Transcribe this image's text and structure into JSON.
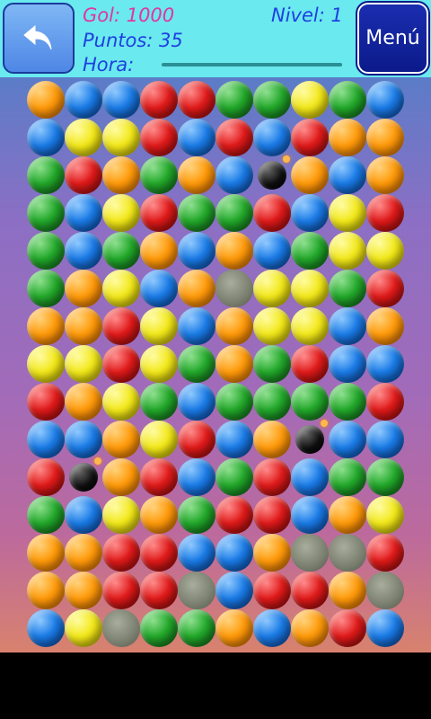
{
  "header": {
    "gol_label": "Gol: 1000",
    "nivel_label": "Nivel: 1",
    "puntos_label": "Puntos: 35",
    "hora_label": "Hora:",
    "menu_label": "Menú",
    "time_remaining_fraction": 1.0
  },
  "colors": {
    "orange": "#ff9a0a",
    "blue": "#1a7be6",
    "red": "#e01a1a",
    "green": "#22a82a",
    "yellow": "#f2e81a",
    "rock": "#7d8272",
    "bomb": "#111111"
  },
  "board": {
    "rows": [
      [
        "O",
        "B",
        "B",
        "R",
        "R",
        "G",
        "G",
        "Y",
        "G",
        "B"
      ],
      [
        "B",
        "Y",
        "Y",
        "R",
        "B",
        "R",
        "B",
        "R",
        "O",
        "O"
      ],
      [
        "G",
        "R",
        "O",
        "G",
        "O",
        "B",
        "X",
        "O",
        "B",
        "O"
      ],
      [
        "G",
        "B",
        "Y",
        "R",
        "G",
        "G",
        "R",
        "B",
        "Y",
        "R"
      ],
      [
        "G",
        "B",
        "G",
        "O",
        "B",
        "O",
        "B",
        "G",
        "Y",
        "Y"
      ],
      [
        "G",
        "O",
        "Y",
        "B",
        "O",
        "K",
        "Y",
        "Y",
        "G",
        "R"
      ],
      [
        "O",
        "O",
        "R",
        "Y",
        "B",
        "O",
        "Y",
        "Y",
        "B",
        "O"
      ],
      [
        "Y",
        "Y",
        "R",
        "Y",
        "G",
        "O",
        "G",
        "R",
        "B",
        "B"
      ],
      [
        "R",
        "O",
        "Y",
        "G",
        "B",
        "G",
        "G",
        "G",
        "G",
        "R"
      ],
      [
        "B",
        "B",
        "O",
        "Y",
        "R",
        "B",
        "O",
        "X",
        "B",
        "B"
      ],
      [
        "R",
        "X",
        "O",
        "R",
        "B",
        "G",
        "R",
        "B",
        "G",
        "G"
      ],
      [
        "G",
        "B",
        "Y",
        "O",
        "G",
        "R",
        "R",
        "B",
        "O",
        "Y"
      ],
      [
        "O",
        "O",
        "R",
        "R",
        "B",
        "B",
        "O",
        "K",
        "K",
        "R"
      ],
      [
        "O",
        "O",
        "R",
        "R",
        "K",
        "B",
        "R",
        "R",
        "O",
        "K"
      ],
      [
        "B",
        "Y",
        "K",
        "G",
        "G",
        "O",
        "B",
        "O",
        "R",
        "B"
      ]
    ]
  }
}
